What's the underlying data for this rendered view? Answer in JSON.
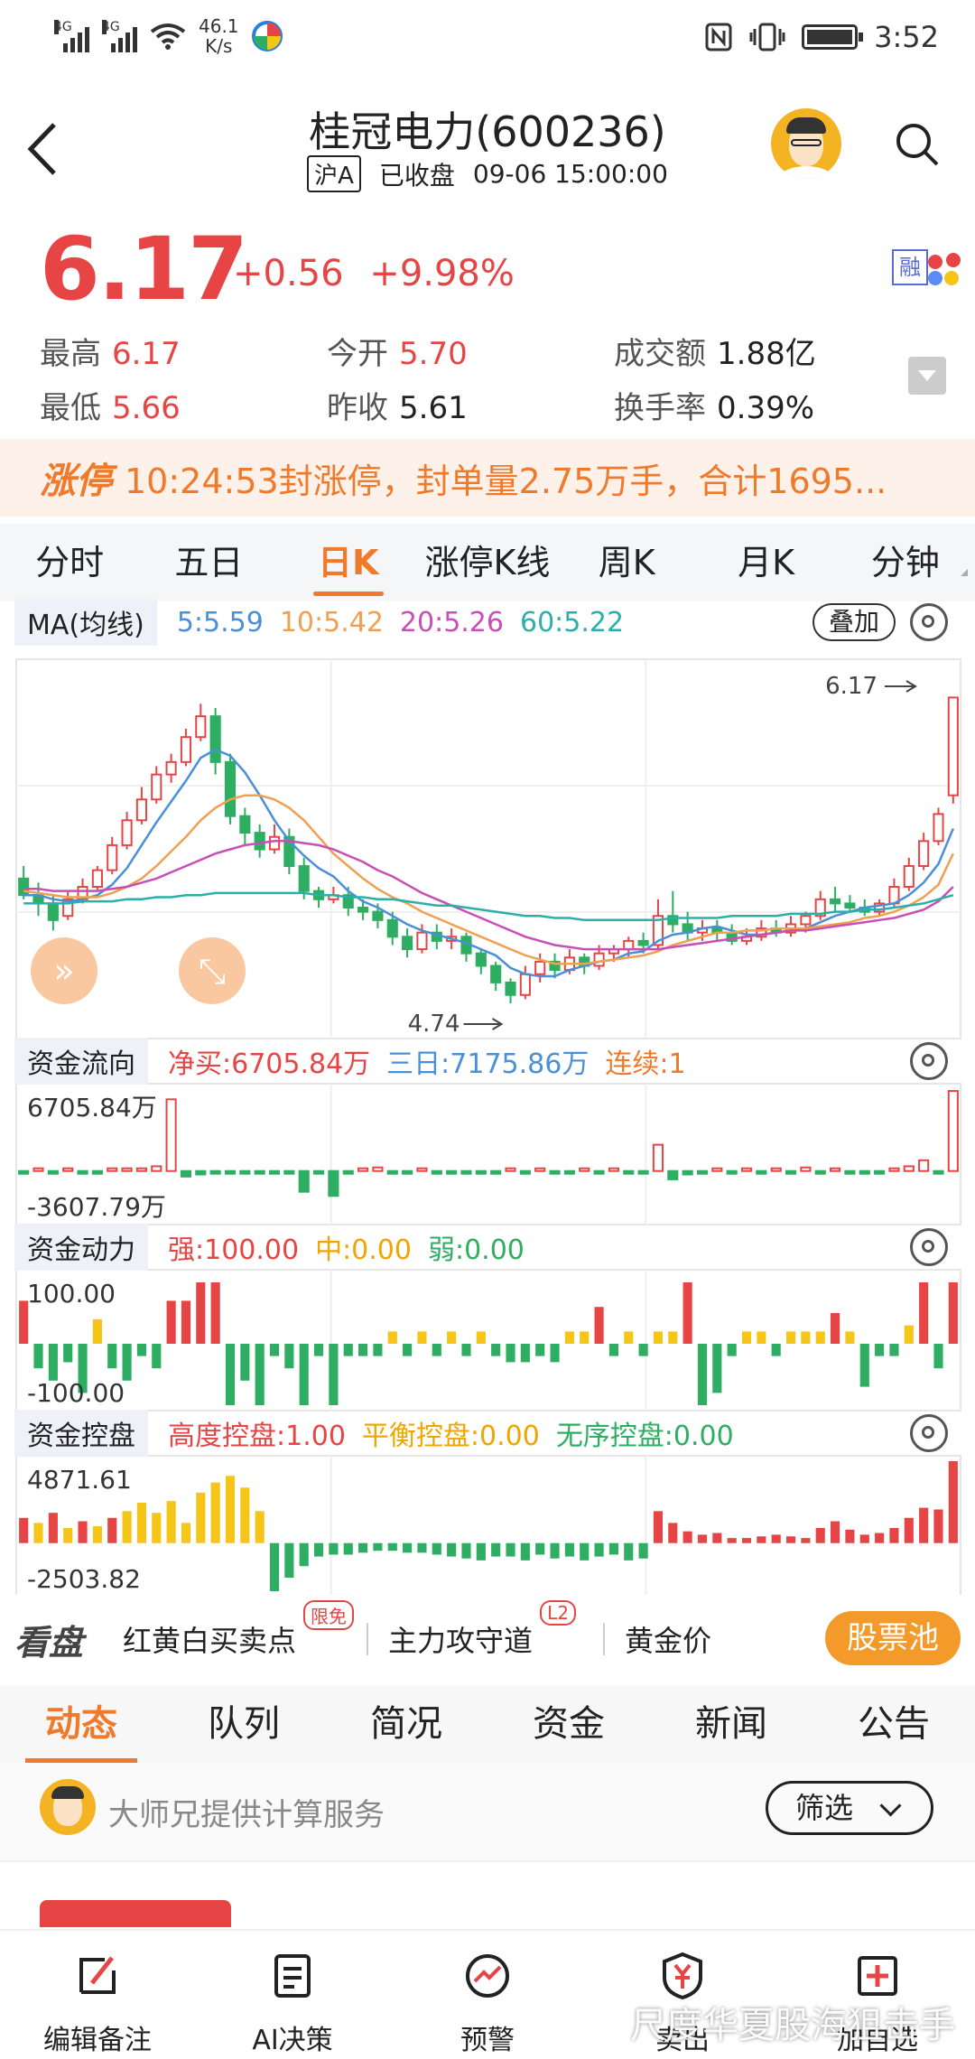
{
  "status": {
    "net1": "4G",
    "net2": "4G",
    "speed": "46.1\nK/s",
    "speed_value": "46.1",
    "speed_unit": "K/s",
    "time": "3:52"
  },
  "header": {
    "title": "桂冠电力(600236)",
    "market": "沪A",
    "state": "已收盘",
    "datetime": "09-06 15:00:00"
  },
  "quote": {
    "price": "6.17",
    "change": "+0.56",
    "change_pct": "+9.98%",
    "rong": "融",
    "rows": [
      [
        {
          "label": "最高",
          "value": "6.17",
          "color": "red"
        },
        {
          "label": "今开",
          "value": "5.70",
          "color": "red"
        },
        {
          "label": "成交额",
          "value": "1.88亿",
          "color": "dark"
        }
      ],
      [
        {
          "label": "最低",
          "value": "5.66",
          "color": "red"
        },
        {
          "label": "昨收",
          "value": "5.61",
          "color": "dark"
        },
        {
          "label": "换手率",
          "value": "0.39%",
          "color": "dark"
        }
      ]
    ]
  },
  "limit_banner": {
    "tag": "涨停",
    "text": "10:24:53封涨停，封单量2.75万手，合计1695..."
  },
  "chart_tabs": [
    "分时",
    "五日",
    "日K",
    "涨停K线",
    "周K",
    "月K",
    "分钟"
  ],
  "active_chart_tab": 2,
  "colors": {
    "red": "#e74545",
    "green": "#2eae62",
    "yellow": "#f5c518",
    "orange": "#ef7a2c",
    "ma5": "#4a90d9",
    "ma10": "#f0a050",
    "ma20": "#c84fb5",
    "ma60": "#2ab0a8"
  },
  "ma_panel": {
    "title": "MA(均线)",
    "ma5": "5:5.59",
    "ma10": "10:5.42",
    "ma20": "20:5.26",
    "ma60": "60:5.22",
    "overlay": "叠加",
    "high_label": "6.17",
    "low_label": "4.74"
  },
  "flow_panel": {
    "title": "资金流向",
    "net": "净买:6705.84万",
    "three_day": "三日:7175.86万",
    "streak": "连续:1",
    "max": "6705.84万",
    "min": "-3607.79万"
  },
  "power_panel": {
    "title": "资金动力",
    "strong": "强:100.00",
    "mid": "中:0.00",
    "weak": "弱:0.00",
    "max": "100.00",
    "min": "-100.00"
  },
  "control_panel": {
    "title": "资金控盘",
    "high": "高度控盘:1.00",
    "balance": "平衡控盘:0.00",
    "none": "无序控盘:0.00",
    "max": "4871.61",
    "min": "-2503.82"
  },
  "tools": {
    "title": "看盘",
    "item1": "红黄白买卖点",
    "item1_badge": "限免",
    "item2": "主力攻守道",
    "item2_badge": "L2",
    "item3": "黄金价",
    "pool": "股票池"
  },
  "news_tabs": [
    "动态",
    "队列",
    "简况",
    "资金",
    "新闻",
    "公告"
  ],
  "feed": {
    "text": "大师兄提供计算服务",
    "filter": "筛选"
  },
  "bottom_nav": [
    {
      "label": "编辑备注",
      "icon": "edit-icon"
    },
    {
      "label": "AI决策",
      "icon": "ai-doc-icon"
    },
    {
      "label": "预警",
      "icon": "alert-chart-icon"
    },
    {
      "label": "卖出",
      "icon": "yuan-shield-icon"
    },
    {
      "label": "加自选",
      "icon": "add-box-icon"
    }
  ],
  "watermark": "尺度华夏股海狙击手",
  "chart_data": {
    "type": "candlestick",
    "y_range": [
      4.6,
      6.25
    ],
    "candles": [
      [
        5.3,
        5.22,
        5.36,
        5.2
      ],
      [
        5.22,
        5.18,
        5.28,
        5.12
      ],
      [
        5.18,
        5.1,
        5.22,
        5.05
      ],
      [
        5.12,
        5.2,
        5.24,
        5.1
      ],
      [
        5.2,
        5.26,
        5.3,
        5.18
      ],
      [
        5.26,
        5.34,
        5.36,
        5.24
      ],
      [
        5.34,
        5.46,
        5.5,
        5.32
      ],
      [
        5.46,
        5.58,
        5.62,
        5.44
      ],
      [
        5.58,
        5.68,
        5.74,
        5.56
      ],
      [
        5.68,
        5.8,
        5.84,
        5.66
      ],
      [
        5.8,
        5.86,
        5.9,
        5.76
      ],
      [
        5.86,
        5.98,
        6.02,
        5.84
      ],
      [
        5.98,
        6.08,
        6.14,
        5.96
      ],
      [
        6.08,
        5.86,
        6.12,
        5.8
      ],
      [
        5.86,
        5.6,
        5.9,
        5.56
      ],
      [
        5.6,
        5.52,
        5.64,
        5.46
      ],
      [
        5.52,
        5.44,
        5.56,
        5.4
      ],
      [
        5.44,
        5.5,
        5.56,
        5.42
      ],
      [
        5.5,
        5.36,
        5.54,
        5.32
      ],
      [
        5.36,
        5.24,
        5.4,
        5.2
      ],
      [
        5.24,
        5.2,
        5.26,
        5.16
      ],
      [
        5.2,
        5.22,
        5.26,
        5.18
      ],
      [
        5.22,
        5.16,
        5.26,
        5.12
      ],
      [
        5.16,
        5.14,
        5.2,
        5.1
      ],
      [
        5.14,
        5.1,
        5.18,
        5.06
      ],
      [
        5.1,
        5.02,
        5.14,
        4.98
      ],
      [
        5.02,
        4.96,
        5.06,
        4.92
      ],
      [
        4.96,
        5.04,
        5.08,
        4.94
      ],
      [
        5.04,
        5.0,
        5.08,
        4.96
      ],
      [
        5.0,
        5.02,
        5.06,
        4.96
      ],
      [
        5.02,
        4.94,
        5.04,
        4.9
      ],
      [
        4.94,
        4.88,
        4.96,
        4.84
      ],
      [
        4.88,
        4.8,
        4.9,
        4.76
      ],
      [
        4.8,
        4.74,
        4.82,
        4.7
      ],
      [
        4.74,
        4.84,
        4.88,
        4.72
      ],
      [
        4.84,
        4.9,
        4.94,
        4.8
      ],
      [
        4.9,
        4.86,
        4.94,
        4.82
      ],
      [
        4.86,
        4.92,
        4.96,
        4.84
      ],
      [
        4.92,
        4.88,
        4.94,
        4.84
      ],
      [
        4.88,
        4.94,
        4.98,
        4.86
      ],
      [
        4.94,
        4.96,
        4.98,
        4.9
      ],
      [
        4.96,
        5.0,
        5.02,
        4.92
      ],
      [
        5.0,
        4.98,
        5.04,
        4.94
      ],
      [
        4.98,
        5.12,
        5.2,
        4.96
      ],
      [
        5.12,
        5.08,
        5.24,
        5.04
      ],
      [
        5.08,
        5.04,
        5.14,
        5.0
      ],
      [
        5.04,
        5.06,
        5.1,
        5.0
      ],
      [
        5.06,
        5.04,
        5.1,
        5.0
      ],
      [
        5.04,
        5.0,
        5.08,
        4.98
      ],
      [
        5.0,
        5.02,
        5.06,
        4.98
      ],
      [
        5.02,
        5.06,
        5.1,
        5.0
      ],
      [
        5.06,
        5.04,
        5.1,
        5.02
      ],
      [
        5.04,
        5.08,
        5.12,
        5.02
      ],
      [
        5.08,
        5.12,
        5.14,
        5.04
      ],
      [
        5.12,
        5.2,
        5.24,
        5.1
      ],
      [
        5.2,
        5.18,
        5.26,
        5.14
      ],
      [
        5.18,
        5.16,
        5.22,
        5.14
      ],
      [
        5.16,
        5.14,
        5.2,
        5.12
      ],
      [
        5.14,
        5.18,
        5.2,
        5.12
      ],
      [
        5.18,
        5.26,
        5.3,
        5.16
      ],
      [
        5.26,
        5.36,
        5.4,
        5.24
      ],
      [
        5.36,
        5.48,
        5.52,
        5.34
      ],
      [
        5.48,
        5.61,
        5.64,
        5.46
      ],
      [
        5.7,
        6.17,
        6.17,
        5.66
      ]
    ],
    "ma5": [
      5.22,
      5.22,
      5.2,
      5.19,
      5.2,
      5.22,
      5.27,
      5.35,
      5.46,
      5.57,
      5.67,
      5.77,
      5.88,
      5.92,
      5.89,
      5.81,
      5.7,
      5.58,
      5.48,
      5.41,
      5.35,
      5.31,
      5.24,
      5.19,
      5.16,
      5.12,
      5.08,
      5.05,
      5.03,
      5.01,
      4.99,
      4.96,
      4.93,
      4.87,
      4.84,
      4.83,
      4.83,
      4.86,
      4.88,
      4.9,
      4.91,
      4.94,
      4.95,
      5.0,
      5.03,
      5.04,
      5.06,
      5.07,
      5.05,
      5.03,
      5.03,
      5.04,
      5.05,
      5.06,
      5.09,
      5.12,
      5.14,
      5.16,
      5.17,
      5.18,
      5.22,
      5.28,
      5.37,
      5.54
    ],
    "ma10": [
      5.24,
      5.23,
      5.22,
      5.21,
      5.21,
      5.21,
      5.23,
      5.26,
      5.3,
      5.36,
      5.43,
      5.5,
      5.58,
      5.64,
      5.68,
      5.7,
      5.7,
      5.68,
      5.64,
      5.58,
      5.5,
      5.42,
      5.36,
      5.3,
      5.25,
      5.21,
      5.18,
      5.14,
      5.11,
      5.08,
      5.05,
      5.02,
      4.99,
      4.96,
      4.93,
      4.91,
      4.89,
      4.89,
      4.89,
      4.9,
      4.91,
      4.92,
      4.93,
      4.95,
      4.98,
      5.0,
      5.02,
      5.04,
      5.04,
      5.05,
      5.05,
      5.06,
      5.06,
      5.06,
      5.07,
      5.08,
      5.09,
      5.11,
      5.12,
      5.14,
      5.17,
      5.21,
      5.27,
      5.42
    ],
    "ma20": [
      5.25,
      5.25,
      5.24,
      5.24,
      5.24,
      5.24,
      5.25,
      5.26,
      5.28,
      5.3,
      5.33,
      5.36,
      5.39,
      5.42,
      5.44,
      5.46,
      5.47,
      5.48,
      5.48,
      5.47,
      5.46,
      5.44,
      5.41,
      5.38,
      5.34,
      5.31,
      5.27,
      5.23,
      5.2,
      5.17,
      5.14,
      5.11,
      5.08,
      5.05,
      5.02,
      5.0,
      4.98,
      4.97,
      4.96,
      4.96,
      4.96,
      4.96,
      4.96,
      4.96,
      4.97,
      4.98,
      4.99,
      5.0,
      5.01,
      5.02,
      5.03,
      5.04,
      5.05,
      5.05,
      5.06,
      5.07,
      5.08,
      5.09,
      5.1,
      5.11,
      5.13,
      5.15,
      5.19,
      5.26
    ],
    "ma60": [
      5.18,
      5.18,
      5.18,
      5.18,
      5.19,
      5.19,
      5.19,
      5.2,
      5.2,
      5.21,
      5.21,
      5.22,
      5.22,
      5.23,
      5.23,
      5.23,
      5.23,
      5.23,
      5.23,
      5.23,
      5.22,
      5.22,
      5.21,
      5.21,
      5.2,
      5.2,
      5.19,
      5.18,
      5.17,
      5.17,
      5.16,
      5.15,
      5.14,
      5.13,
      5.12,
      5.12,
      5.11,
      5.11,
      5.1,
      5.1,
      5.1,
      5.1,
      5.1,
      5.1,
      5.11,
      5.11,
      5.11,
      5.11,
      5.12,
      5.12,
      5.12,
      5.12,
      5.13,
      5.13,
      5.13,
      5.14,
      5.14,
      5.15,
      5.15,
      5.16,
      5.17,
      5.18,
      5.2,
      5.22
    ],
    "flow": [
      -300,
      100,
      -200,
      150,
      -300,
      -200,
      100,
      200,
      150,
      400,
      6000,
      -800,
      -500,
      -300,
      -100,
      -200,
      -100,
      -300,
      -100,
      -3000,
      -200,
      -3600,
      -100,
      100,
      300,
      -200,
      -100,
      100,
      -200,
      -100,
      -200,
      -100,
      -200,
      200,
      -100,
      150,
      -200,
      -100,
      200,
      -100,
      100,
      -100,
      -200,
      2200,
      -1200,
      -500,
      -100,
      200,
      -100,
      200,
      -100,
      200,
      -100,
      300,
      -100,
      200,
      -100,
      -300,
      -100,
      200,
      400,
      900,
      -300,
      6700
    ],
    "power": [
      70,
      -40,
      -60,
      -30,
      -80,
      40,
      -40,
      -60,
      -20,
      -40,
      70,
      70,
      100,
      100,
      -100,
      -60,
      -100,
      -20,
      -40,
      -100,
      -20,
      -100,
      -20,
      -20,
      -20,
      20,
      -20,
      20,
      -20,
      20,
      -20,
      20,
      -20,
      -30,
      -30,
      -20,
      -30,
      20,
      20,
      60,
      -20,
      20,
      -20,
      20,
      20,
      100,
      -100,
      -80,
      -20,
      20,
      20,
      -20,
      20,
      20,
      20,
      50,
      20,
      -70,
      -20,
      -20,
      30,
      100,
      -40,
      100
    ],
    "control": [
      1500,
      1200,
      1800,
      900,
      1300,
      1000,
      1500,
      1900,
      2400,
      1800,
      2500,
      1200,
      3000,
      3600,
      4000,
      3300,
      1900,
      -2500,
      -1800,
      -1200,
      -700,
      -600,
      -600,
      -500,
      -400,
      -400,
      -500,
      -500,
      -600,
      -700,
      -800,
      -900,
      -700,
      -700,
      -900,
      -600,
      -800,
      -700,
      -900,
      -700,
      -600,
      -900,
      -800,
      1900,
      1200,
      700,
      500,
      600,
      300,
      300,
      400,
      500,
      400,
      300,
      900,
      1300,
      800,
      500,
      600,
      900,
      1500,
      2100,
      2000,
      4871
    ]
  }
}
